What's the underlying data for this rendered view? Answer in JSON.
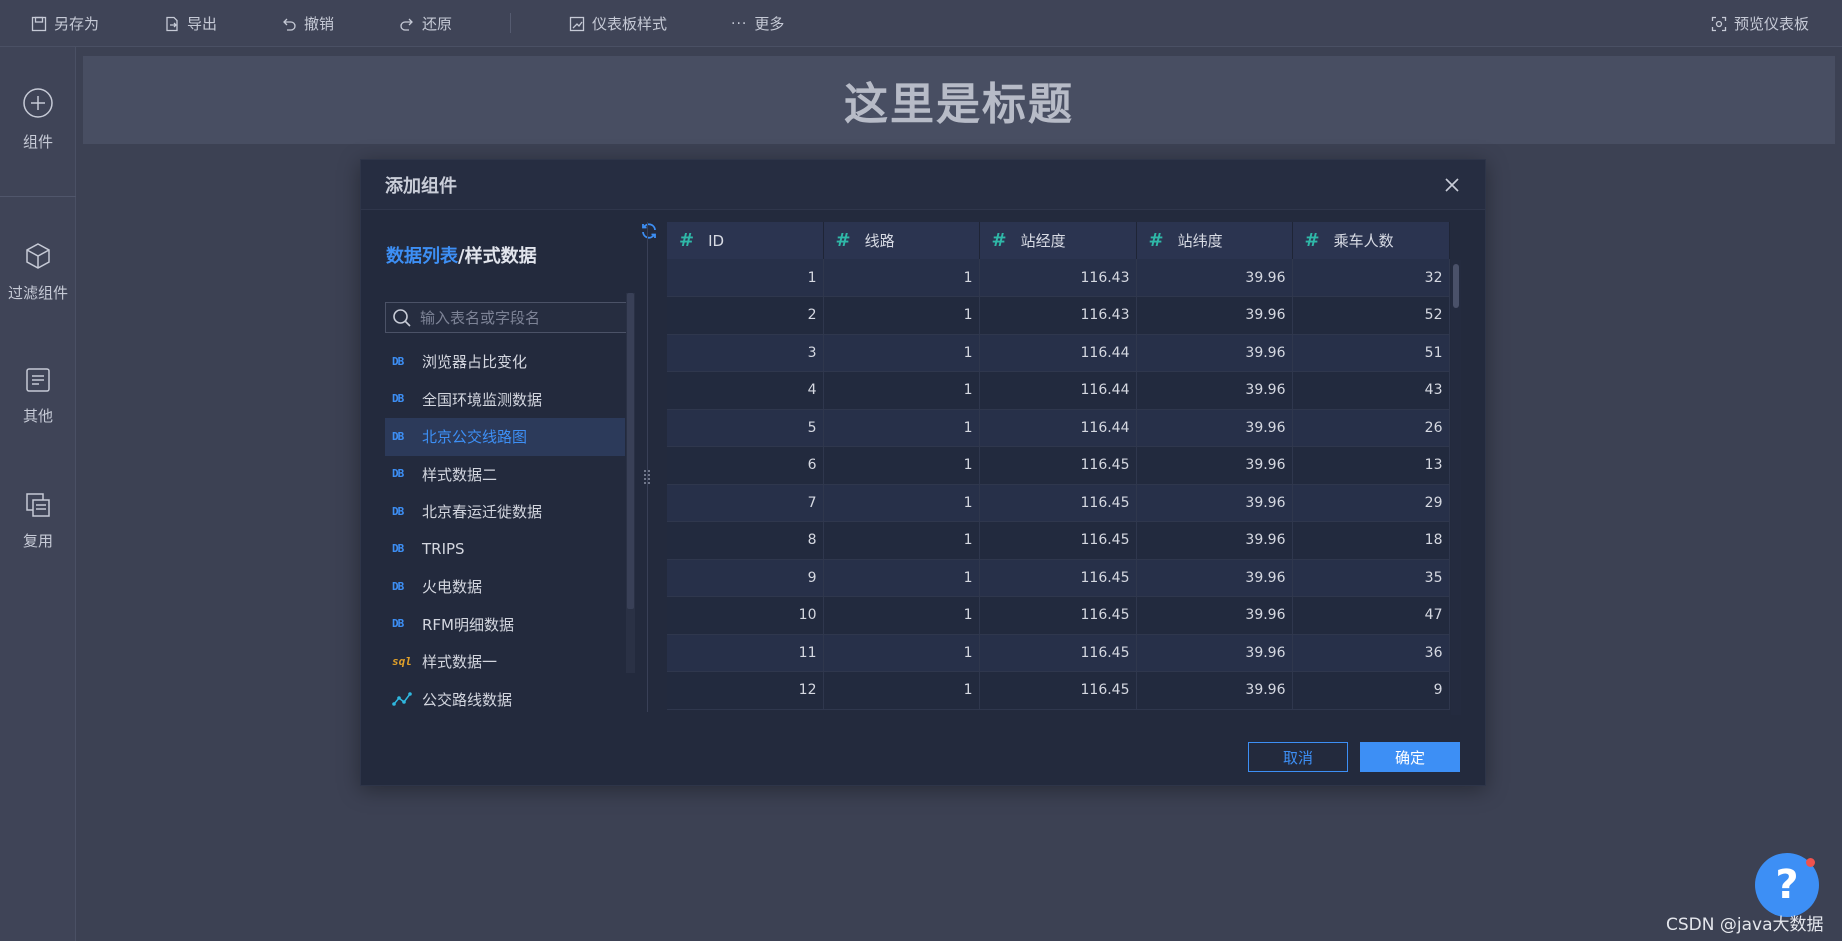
{
  "toolbar": {
    "save_as": "另存为",
    "export": "导出",
    "undo": "撤销",
    "redo": "还原",
    "dashboard_style": "仪表板样式",
    "more": "更多",
    "preview": "预览仪表板"
  },
  "rail": {
    "components": "组件",
    "filter_components": "过滤组件",
    "others": "其他",
    "reuse": "复用"
  },
  "canvas": {
    "title": "这里是标题"
  },
  "modal": {
    "title": "添加组件",
    "breadcrumb_link": "数据列表",
    "breadcrumb_sep": "/",
    "breadcrumb_current": "样式数据",
    "search_placeholder": "输入表名或字段名",
    "datasets": [
      {
        "label": "浏览器占比变化",
        "icon": "db-icon",
        "active": false
      },
      {
        "label": "全国环境监测数据",
        "icon": "db-icon",
        "active": false
      },
      {
        "label": "北京公交线路图",
        "icon": "db-icon",
        "active": true
      },
      {
        "label": "样式数据二",
        "icon": "db-icon",
        "active": false
      },
      {
        "label": "北京春运迁徙数据",
        "icon": "db-icon",
        "active": false
      },
      {
        "label": "TRIPS",
        "icon": "db-icon",
        "active": false
      },
      {
        "label": "火电数据",
        "icon": "db-icon",
        "active": false
      },
      {
        "label": "RFM明细数据",
        "icon": "db-icon",
        "active": false
      },
      {
        "label": "样式数据一",
        "icon": "sql-icon",
        "active": false
      },
      {
        "label": "公交路线数据",
        "icon": "graph-icon",
        "active": false
      }
    ],
    "table": {
      "columns": [
        "ID",
        "线路",
        "站经度",
        "站纬度",
        "乘车人数"
      ],
      "rows": [
        [
          "1",
          "1",
          "116.43",
          "39.96",
          "32"
        ],
        [
          "2",
          "1",
          "116.43",
          "39.96",
          "52"
        ],
        [
          "3",
          "1",
          "116.44",
          "39.96",
          "51"
        ],
        [
          "4",
          "1",
          "116.44",
          "39.96",
          "43"
        ],
        [
          "5",
          "1",
          "116.44",
          "39.96",
          "26"
        ],
        [
          "6",
          "1",
          "116.45",
          "39.96",
          "13"
        ],
        [
          "7",
          "1",
          "116.45",
          "39.96",
          "29"
        ],
        [
          "8",
          "1",
          "116.45",
          "39.96",
          "18"
        ],
        [
          "9",
          "1",
          "116.45",
          "39.96",
          "35"
        ],
        [
          "10",
          "1",
          "116.45",
          "39.96",
          "47"
        ],
        [
          "11",
          "1",
          "116.45",
          "39.96",
          "36"
        ],
        [
          "12",
          "1",
          "116.45",
          "39.96",
          "9"
        ]
      ]
    },
    "cancel_label": "取消",
    "ok_label": "确定"
  },
  "help_label": "?",
  "watermark": "CSDN @java大数据",
  "colors": {
    "accent": "#3d8ff5",
    "hash": "#2fb8a8",
    "sql": "#e0a02a",
    "notification": "#f0524d"
  }
}
